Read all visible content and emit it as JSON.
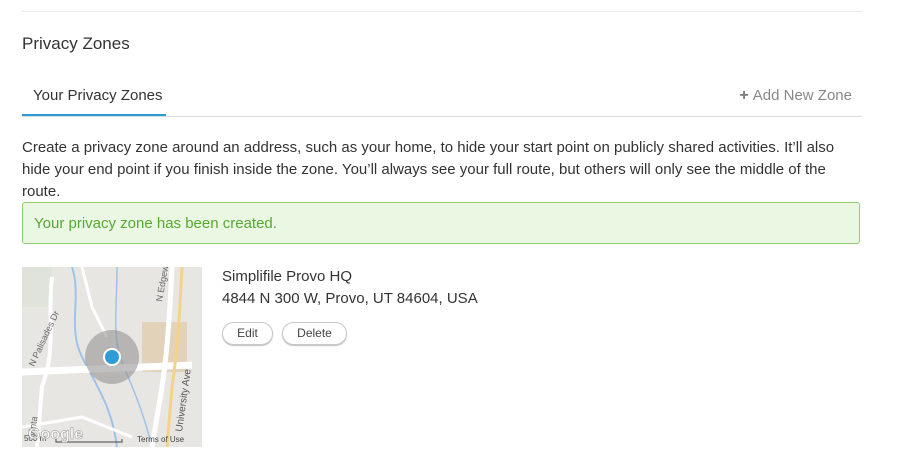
{
  "section": {
    "title": "Privacy Zones"
  },
  "tabs": {
    "active": "Your Privacy Zones",
    "add_new": "Add New Zone"
  },
  "description": "Create a privacy zone around an address, such as your home, to hide your start point on publicly shared activities. It’ll also hide your end point if you finish inside the zone. You’ll always see your full route, but others will only see the middle of the route.",
  "alert": {
    "message": "Your privacy zone has been created.",
    "color": "#58a832",
    "background": "#eaf7e3"
  },
  "zone": {
    "name": "Simplifile Provo HQ",
    "address": "4844 N 300 W, Provo, UT 84604, USA",
    "edit_label": "Edit",
    "delete_label": "Delete"
  },
  "map": {
    "street_labels": [
      "N Palisades Dr",
      "N Edgew",
      "University Ave",
      "Vinta"
    ],
    "scale_label": "500 m",
    "brand": "Google",
    "terms": "Terms of Use",
    "marker_color": "#2d9bd6"
  },
  "colors": {
    "accent": "#2d9bd6"
  }
}
